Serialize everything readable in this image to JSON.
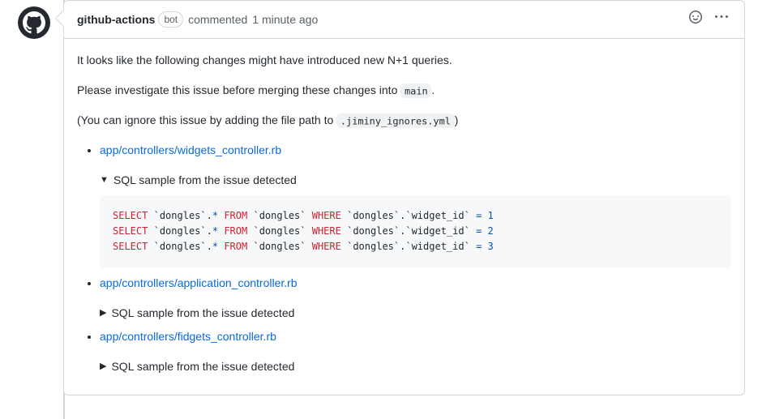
{
  "header": {
    "author": "github-actions",
    "bot_badge": "bot",
    "action": "commented",
    "timestamp": "1 minute ago"
  },
  "body": {
    "intro": "It looks like the following changes might have introduced new N+1 queries.",
    "investigate_prefix": "Please investigate this issue before merging these changes into ",
    "investigate_code": "main",
    "investigate_suffix": ".",
    "ignore_prefix": "(You can ignore this issue by adding the file path to ",
    "ignore_code": ".jiminy_ignores.yml",
    "ignore_suffix": ")"
  },
  "files": [
    {
      "path": "app/controllers/widgets_controller.rb",
      "summary": "SQL sample from the issue detected",
      "open": true,
      "sql": [
        {
          "table": "dongles",
          "col": "widget_id",
          "val": "1"
        },
        {
          "table": "dongles",
          "col": "widget_id",
          "val": "2"
        },
        {
          "table": "dongles",
          "col": "widget_id",
          "val": "3"
        }
      ]
    },
    {
      "path": "app/controllers/application_controller.rb",
      "summary": "SQL sample from the issue detected",
      "open": false
    },
    {
      "path": "app/controllers/fidgets_controller.rb",
      "summary": "SQL sample from the issue detected",
      "open": false
    }
  ]
}
